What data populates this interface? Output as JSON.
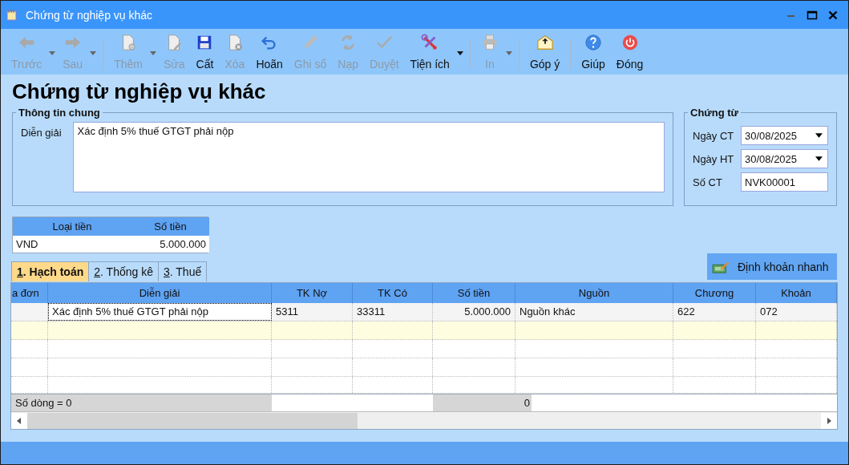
{
  "window": {
    "title": "Chứng từ nghiệp vụ khác"
  },
  "toolbar": [
    {
      "kind": "button",
      "label": "Trước",
      "disabled": true,
      "dropdown": true
    },
    {
      "kind": "button",
      "label": "Sau",
      "disabled": true,
      "dropdown": true
    },
    {
      "kind": "separator"
    },
    {
      "kind": "button",
      "label": "Thêm",
      "disabled": true,
      "dropdown": true
    },
    {
      "kind": "button",
      "label": "Sửa",
      "disabled": true,
      "dropdown": false
    },
    {
      "kind": "button",
      "label": "Cất",
      "disabled": false,
      "dropdown": false
    },
    {
      "kind": "button",
      "label": "Xóa",
      "disabled": true,
      "dropdown": false
    },
    {
      "kind": "button",
      "label": "Hoãn",
      "disabled": false,
      "dropdown": false
    },
    {
      "kind": "button",
      "label": "Ghi sổ",
      "disabled": true,
      "dropdown": false
    },
    {
      "kind": "button",
      "label": "Nạp",
      "disabled": true,
      "dropdown": false
    },
    {
      "kind": "button",
      "label": "Duyệt",
      "disabled": true,
      "dropdown": false
    },
    {
      "kind": "button",
      "label": "Tiện ích",
      "disabled": false,
      "dropdown": true
    },
    {
      "kind": "separator"
    },
    {
      "kind": "button",
      "label": "In",
      "disabled": true,
      "dropdown": true
    },
    {
      "kind": "separator"
    },
    {
      "kind": "button",
      "label": "Góp ý",
      "disabled": false,
      "dropdown": false
    },
    {
      "kind": "separator"
    },
    {
      "kind": "button",
      "label": "Giúp",
      "disabled": false,
      "dropdown": false
    },
    {
      "kind": "button",
      "label": "Đóng",
      "disabled": false,
      "dropdown": false
    }
  ],
  "heading": "Chứng từ nghiệp vụ khác",
  "general": {
    "legend": "Thông tin chung",
    "description_label": "Diễn giải",
    "description": "Xác định 5% thuế GTGT phải nộp"
  },
  "document": {
    "legend": "Chứng từ",
    "fields": [
      {
        "kind": "date",
        "label": "Ngày CT",
        "value": "30/08/2025"
      },
      {
        "kind": "date",
        "label": "Ngày HT",
        "value": "30/08/2025"
      },
      {
        "kind": "text",
        "label": "Số CT",
        "value": "NVK00001"
      }
    ]
  },
  "currency": {
    "columns": [
      "Loại tiền",
      "Số tiền"
    ],
    "row": [
      "VND",
      "5.000.000"
    ]
  },
  "tabs": [
    {
      "label": "1. Hạch toán",
      "selected": true
    },
    {
      "label": "2. Thống kê",
      "selected": false
    },
    {
      "label": "3. Thuế",
      "selected": false
    }
  ],
  "quick_entry_button": "Định khoản nhanh",
  "grid": {
    "columns": [
      {
        "label": "a đơn"
      },
      {
        "label": "Diễn giải",
        "kind": "text"
      },
      {
        "label": "TK Nợ",
        "kind": "text"
      },
      {
        "label": "TK Có",
        "kind": "text"
      },
      {
        "label": "Số tiền",
        "kind": "amount"
      },
      {
        "label": "Nguồn",
        "kind": "text"
      },
      {
        "label": "Chương",
        "kind": "text"
      },
      {
        "label": "Khoản",
        "kind": "text"
      }
    ],
    "rows": [
      {
        "kind": "data",
        "cells": [
          null,
          "Xác định 5% thuế GTGT phải nộp",
          "5311",
          "33311",
          "5.000.000",
          "Nguồn khác",
          "622",
          "072"
        ]
      },
      {
        "kind": "new"
      },
      {
        "kind": "empty"
      },
      {
        "kind": "empty"
      },
      {
        "kind": "partial"
      }
    ],
    "footer": {
      "row_count": "Số dòng = 0",
      "total": "0"
    }
  }
}
